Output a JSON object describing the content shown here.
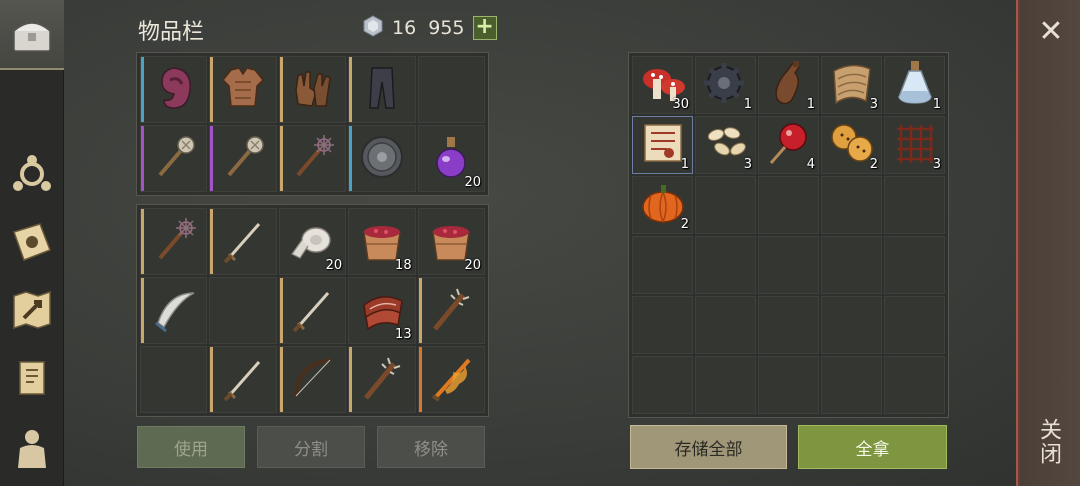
{
  "header": {
    "title": "物品栏",
    "currency_value": "16  955",
    "plus_label": "+"
  },
  "close": {
    "x_label": "✕",
    "label": "关闭"
  },
  "sidebar": {
    "items": [
      {
        "name": "chest-icon",
        "active": true
      },
      {
        "name": "crafting-icon",
        "active": false
      },
      {
        "name": "skills-book-icon",
        "active": false
      },
      {
        "name": "map-icon",
        "active": false
      },
      {
        "name": "quest-scroll-icon",
        "active": false
      },
      {
        "name": "character-icon",
        "active": false
      }
    ]
  },
  "equipment": [
    {
      "icon": "hood",
      "count": "",
      "bar": "#49a3c3"
    },
    {
      "icon": "chest-armor",
      "count": "",
      "bar": "#c9a66b"
    },
    {
      "icon": "gloves",
      "count": "",
      "bar": "#c9a66b"
    },
    {
      "icon": "pants",
      "count": "",
      "bar": "#c9a66b"
    },
    {
      "icon": "",
      "count": "",
      "bar": ""
    },
    {
      "icon": "mace",
      "count": "",
      "bar": "#a154c8"
    },
    {
      "icon": "mace",
      "count": "",
      "bar": "#a154c8"
    },
    {
      "icon": "spiked-mace",
      "count": "",
      "bar": "#c9a66b"
    },
    {
      "icon": "shield",
      "count": "",
      "bar": "#49a3c3"
    },
    {
      "icon": "purple-potion",
      "count": "20",
      "bar": ""
    }
  ],
  "backpack": [
    {
      "icon": "spiked-mace",
      "count": "",
      "bar": "#c9a66b"
    },
    {
      "icon": "sword",
      "count": "",
      "bar": "#c9a66b"
    },
    {
      "icon": "bandage",
      "count": "20",
      "bar": ""
    },
    {
      "icon": "berry-bucket",
      "count": "18",
      "bar": ""
    },
    {
      "icon": "berry-bucket",
      "count": "20",
      "bar": ""
    },
    {
      "icon": "scimitar",
      "count": "",
      "bar": "#c9a66b"
    },
    {
      "icon": "",
      "count": "",
      "bar": ""
    },
    {
      "icon": "sword",
      "count": "",
      "bar": "#c9a66b"
    },
    {
      "icon": "meat",
      "count": "13",
      "bar": ""
    },
    {
      "icon": "spiked-club",
      "count": "",
      "bar": "#c9a66b"
    },
    {
      "icon": "",
      "count": "",
      "bar": ""
    },
    {
      "icon": "sword",
      "count": "",
      "bar": "#c9a66b"
    },
    {
      "icon": "bow",
      "count": "",
      "bar": "#c9a66b"
    },
    {
      "icon": "spiked-club",
      "count": "",
      "bar": "#c9a66b"
    },
    {
      "icon": "fire-sword",
      "count": "",
      "bar": "#d9772c"
    }
  ],
  "buttons": {
    "use": "使用",
    "split": "分割",
    "remove": "移除",
    "store_all": "存储全部",
    "take_all": "全拿"
  },
  "storage": [
    {
      "icon": "mushrooms",
      "count": "30"
    },
    {
      "icon": "gear",
      "count": "1"
    },
    {
      "icon": "bottle",
      "count": "1"
    },
    {
      "icon": "cloth",
      "count": "3"
    },
    {
      "icon": "flask",
      "count": "1"
    },
    {
      "icon": "recipe-scroll",
      "count": "1"
    },
    {
      "icon": "seeds",
      "count": "3"
    },
    {
      "icon": "candy-apple",
      "count": "4"
    },
    {
      "icon": "cookies",
      "count": "2"
    },
    {
      "icon": "rope-net",
      "count": "3"
    },
    {
      "icon": "pumpkin",
      "count": "2"
    }
  ]
}
